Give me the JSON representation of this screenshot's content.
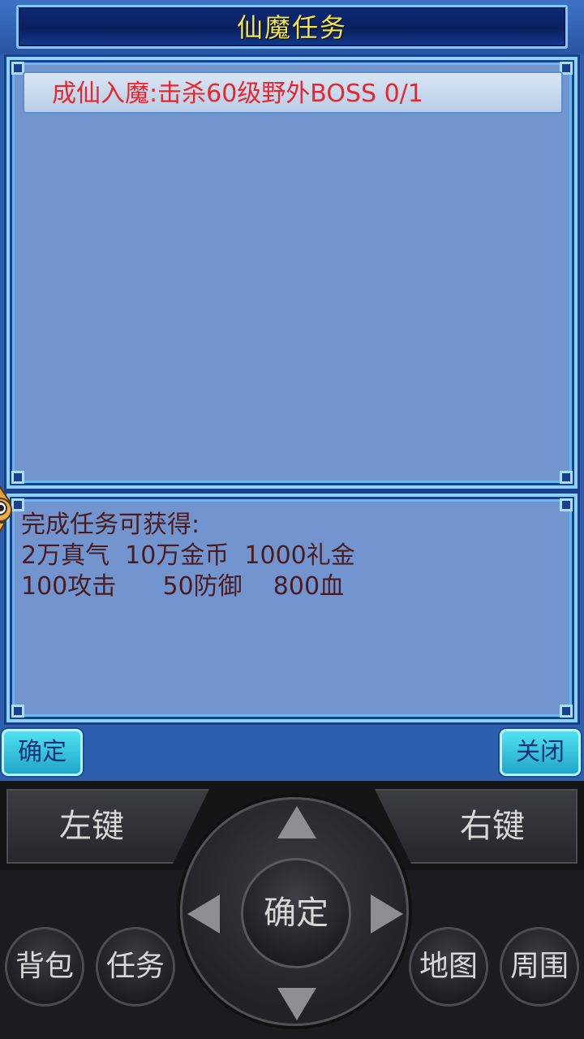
{
  "window": {
    "title": "仙魔任务"
  },
  "quest": {
    "entry": "成仙入魔:击杀60级野外BOSS 0/1"
  },
  "reward": {
    "lines": [
      "完成任务可获得:",
      "2万真气  10万金币  1000礼金",
      "100攻击      50防御    800血"
    ]
  },
  "buttons": {
    "confirm_label": "确定",
    "close_label": "关闭"
  },
  "controller": {
    "left_key": "左键",
    "right_key": "右键",
    "center_key": "确定",
    "bag": "背包",
    "task": "任务",
    "map": "地图",
    "around": "周围"
  }
}
